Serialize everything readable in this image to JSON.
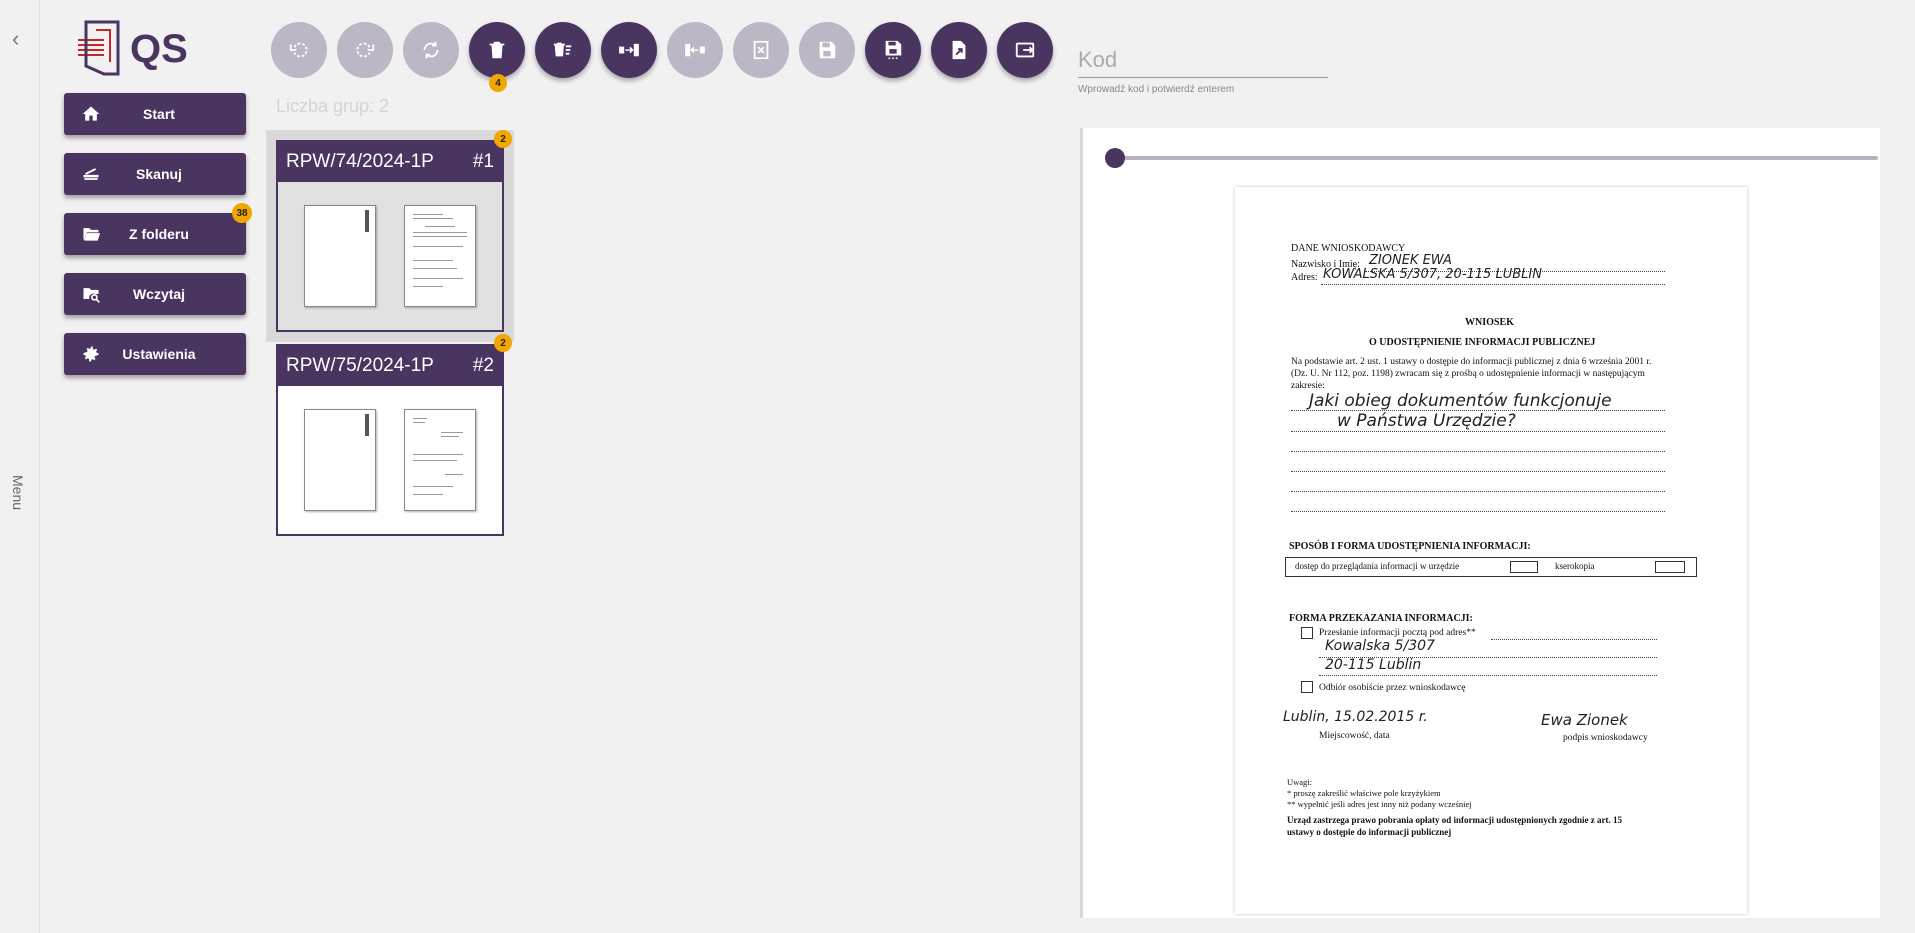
{
  "rail": {
    "collapse_icon": "chevron-left-icon",
    "menu_label": "Menu"
  },
  "logo": {
    "text": "QS"
  },
  "nav": [
    {
      "label": "Start",
      "icon": "home-icon"
    },
    {
      "label": "Skanuj",
      "icon": "scanner-icon"
    },
    {
      "label": "Z folderu",
      "icon": "folder-open-icon",
      "badge": "38"
    },
    {
      "label": "Wczytaj",
      "icon": "folder-search-icon"
    },
    {
      "label": "Ustawienia",
      "icon": "gear-icon"
    }
  ],
  "toolbar": {
    "buttons": [
      {
        "icon": "rotate-left-icon",
        "enabled": false
      },
      {
        "icon": "rotate-right-icon",
        "enabled": false
      },
      {
        "icon": "rotate-180-icon",
        "enabled": false
      },
      {
        "icon": "delete-icon",
        "enabled": true,
        "badge": "4"
      },
      {
        "icon": "delete-sweep-icon",
        "enabled": true
      },
      {
        "icon": "merge-icon",
        "enabled": true
      },
      {
        "icon": "split-icon",
        "enabled": false
      },
      {
        "icon": "delete-group-icon",
        "enabled": false
      },
      {
        "icon": "save-icon",
        "enabled": false
      },
      {
        "icon": "save-as-icon",
        "enabled": true
      },
      {
        "icon": "export-file-icon",
        "enabled": true
      },
      {
        "icon": "send-icon",
        "enabled": true
      }
    ]
  },
  "code": {
    "placeholder": "Kod",
    "hint": "Wprowadź kod i potwierdź enterem"
  },
  "groups": {
    "count_label": "Liczba grup: 2",
    "items": [
      {
        "title": "RPW/74/2024-1P",
        "number": "#1",
        "badge": "2"
      },
      {
        "title": "RPW/75/2024-1P",
        "number": "#2",
        "badge": "2"
      }
    ]
  },
  "preview": {
    "page_index": 1,
    "document": {
      "applicant_header": "DANE WNIOSKODAWCY",
      "name_label": "Nazwisko i Imię:",
      "name_value": "ZIONEK EWA",
      "address_label": "Adres:",
      "address_value": "KOWALSKA 5/307, 20-115 LUBLIN",
      "title": "WNIOSEK",
      "subtitle": "O UDOSTĘPNIENIE INFORMACJI PUBLICZNEJ",
      "intro_1": "Na podstawie art. 2 ust. 1 ustawy o dostępie do informacji publicznej z dnia 6 września 2001 r.",
      "intro_2": "(Dz. U. Nr 112, poz. 1198) zwracam się z prośbą o udostępnienie informacji w następującym",
      "intro_3": "zakresie:",
      "scope_1": "Jaki obieg dokumentów funkcjonuje",
      "scope_2": "w Państwa Urzędzie?",
      "access_header": "SPOSÓB I FORMA UDOSTĘPNIENIA INFORMACJI:",
      "access_opt_1": "dostęp do przeglądania informacji w urzędzie",
      "access_opt_2": "kserokopia",
      "transfer_header": "FORMA PRZEKAZANIA INFORMACJI:",
      "transfer_opt_1": "Przesłanie informacji pocztą pod adres**",
      "transfer_addr_1": "Kowalska 5/307",
      "transfer_addr_2": "20-115 Lublin",
      "transfer_opt_2": "Odbiór osobiście przez wnioskodawcę",
      "place_date_value": "Lublin, 15.02.2015 r.",
      "place_date_label": "Miejscowość, data",
      "signature_value": "Ewa Zionek",
      "signature_label": "podpis wnioskodawcy",
      "notes_header": "Uwagi:",
      "note_1": "* proszę zakreślić właściwe pole krzyżykiem",
      "note_2": "** wypełnić jeśli adres jest inny niż podany wcześniej",
      "fee_1": "Urząd zastrzega prawo pobrania opłaty od informacji udostępnionych zgodnie z art. 15",
      "fee_2": "ustawy o dostępie do informacji publicznej"
    }
  },
  "colors": {
    "primary": "#4a3561",
    "disabled": "#bdb6c4",
    "badge": "#f2a600",
    "logo_red": "#c0282d"
  }
}
